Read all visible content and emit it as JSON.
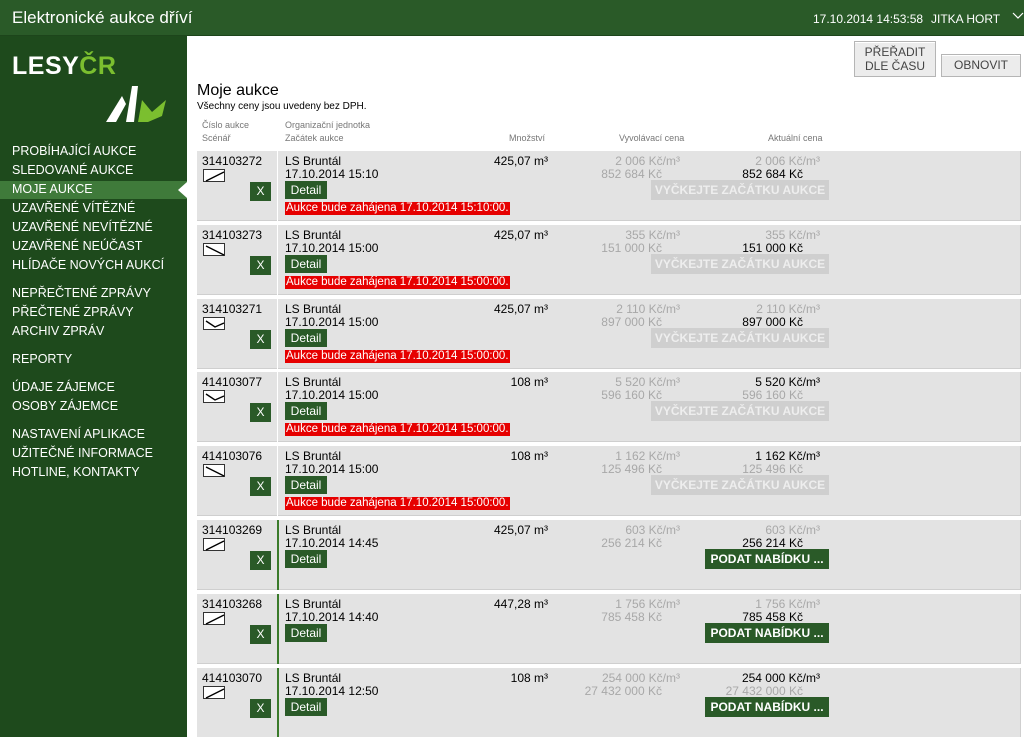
{
  "header": {
    "title": "Elektronické aukce dříví",
    "datetime": "17.10.2014 14:53:58",
    "user": "JITKA HORT"
  },
  "logo": {
    "text_main": "LESY",
    "text_accent": "ČR"
  },
  "colors": {
    "brand_green": "#2a5a28",
    "sidebar": "#1e4a1c",
    "alert_red": "#e60000",
    "accent_green": "#7bbf2f"
  },
  "nav": {
    "group1": [
      "PROBÍHAJÍCÍ AUKCE",
      "SLEDOVANÉ AUKCE",
      "MOJE AUKCE",
      "UZAVŘENÉ VÍTĚZNÉ",
      "UZAVŘENÉ NEVÍTĚZNÉ",
      "UZAVŘENÉ NEÚČAST",
      "HLÍDAČE NOVÝCH AUKCÍ"
    ],
    "group2": [
      "NEPŘEČTENÉ ZPRÁVY",
      "PŘEČTENÉ ZPRÁVY",
      "ARCHIV ZPRÁV"
    ],
    "group3": [
      "REPORTY"
    ],
    "group4": [
      "ÚDAJE ZÁJEMCE",
      "OSOBY ZÁJEMCE"
    ],
    "group5": [
      "NASTAVENÍ APLIKACE",
      "UŽITEČNÉ INFORMACE",
      "HOTLINE, KONTAKTY"
    ],
    "active": "MOJE AUKCE"
  },
  "toolbar": {
    "sort_label_1": "PŘEŘADIT",
    "sort_label_2": "DLE ČASU",
    "refresh_label": "OBNOVIT"
  },
  "page": {
    "title": "Moje aukce",
    "subtitle": "Všechny ceny jsou uvedeny bez DPH."
  },
  "columns": {
    "auction_no": "Číslo aukce",
    "scenario": "Scénář",
    "org_unit": "Organizační jednotka",
    "start": "Začátek aukce",
    "quantity": "Množství",
    "reserve_price": "Vyvolávací cena",
    "current_price": "Aktuální cena"
  },
  "labels": {
    "detail": "Detail",
    "remove": "X",
    "wait": "VYČKEJTE ZAČÁTKU AUKCE",
    "bid": "PODAT NABÍDKU ..."
  },
  "auctions": [
    {
      "id": "314103272",
      "scenario_icon": "scenario-rise-icon",
      "unit": "LS Bruntál",
      "start": "17.10.2014 15:10",
      "qty": "425,07 m³",
      "reserve_unit": "2 006 Kč/m³",
      "reserve_total": "852 684 Kč",
      "current_unit": "2 006 Kč/m³",
      "current_total": "852 684 Kč",
      "unit_dark": false,
      "total_dark": true,
      "status": "waiting",
      "notice": "Aukce bude zahájena 17.10.2014 15:10:00."
    },
    {
      "id": "314103273",
      "scenario_icon": "scenario-fall-icon",
      "unit": "LS Bruntál",
      "start": "17.10.2014 15:00",
      "qty": "425,07 m³",
      "reserve_unit": "355 Kč/m³",
      "reserve_total": "151 000 Kč",
      "current_unit": "355 Kč/m³",
      "current_total": "151 000 Kč",
      "unit_dark": false,
      "total_dark": true,
      "status": "waiting",
      "notice": "Aukce bude zahájena 17.10.2014 15:00:00."
    },
    {
      "id": "314103271",
      "scenario_icon": "scenario-dip-icon",
      "unit": "LS Bruntál",
      "start": "17.10.2014 15:00",
      "qty": "425,07 m³",
      "reserve_unit": "2 110 Kč/m³",
      "reserve_total": "897 000 Kč",
      "current_unit": "2 110 Kč/m³",
      "current_total": "897 000 Kč",
      "unit_dark": false,
      "total_dark": true,
      "status": "waiting",
      "notice": "Aukce bude zahájena 17.10.2014 15:00:00."
    },
    {
      "id": "414103077",
      "scenario_icon": "scenario-dip-icon",
      "unit": "LS Bruntál",
      "start": "17.10.2014 15:00",
      "qty": "108 m³",
      "reserve_unit": "5 520 Kč/m³",
      "reserve_total": "596 160 Kč",
      "current_unit": "5 520 Kč/m³",
      "current_total": "596 160 Kč",
      "unit_dark": true,
      "total_dark": false,
      "status": "waiting",
      "notice": "Aukce bude zahájena 17.10.2014 15:00:00."
    },
    {
      "id": "414103076",
      "scenario_icon": "scenario-fall-icon",
      "unit": "LS Bruntál",
      "start": "17.10.2014 15:00",
      "qty": "108 m³",
      "reserve_unit": "1 162 Kč/m³",
      "reserve_total": "125 496 Kč",
      "current_unit": "1 162 Kč/m³",
      "current_total": "125 496 Kč",
      "unit_dark": true,
      "total_dark": false,
      "status": "waiting",
      "notice": "Aukce bude zahájena 17.10.2014 15:00:00."
    },
    {
      "id": "314103269",
      "scenario_icon": "scenario-rise-icon",
      "unit": "LS Bruntál",
      "start": "17.10.2014 14:45",
      "qty": "425,07 m³",
      "reserve_unit": "603 Kč/m³",
      "reserve_total": "256 214 Kč",
      "current_unit": "603 Kč/m³",
      "current_total": "256 214 Kč",
      "unit_dark": false,
      "total_dark": true,
      "status": "active",
      "notice": ""
    },
    {
      "id": "314103268",
      "scenario_icon": "scenario-rise-icon",
      "unit": "LS Bruntál",
      "start": "17.10.2014 14:40",
      "qty": "447,28 m³",
      "reserve_unit": "1 756 Kč/m³",
      "reserve_total": "785 458 Kč",
      "current_unit": "1 756 Kč/m³",
      "current_total": "785 458 Kč",
      "unit_dark": false,
      "total_dark": true,
      "status": "active",
      "notice": ""
    },
    {
      "id": "414103070",
      "scenario_icon": "scenario-rise-icon",
      "unit": "LS Bruntál",
      "start": "17.10.2014 12:50",
      "qty": "108 m³",
      "reserve_unit": "254 000 Kč/m³",
      "reserve_total": "27 432 000 Kč",
      "current_unit": "254 000 Kč/m³",
      "current_total": "27 432 000 Kč",
      "unit_dark": true,
      "total_dark": false,
      "status": "active",
      "notice": ""
    }
  ]
}
